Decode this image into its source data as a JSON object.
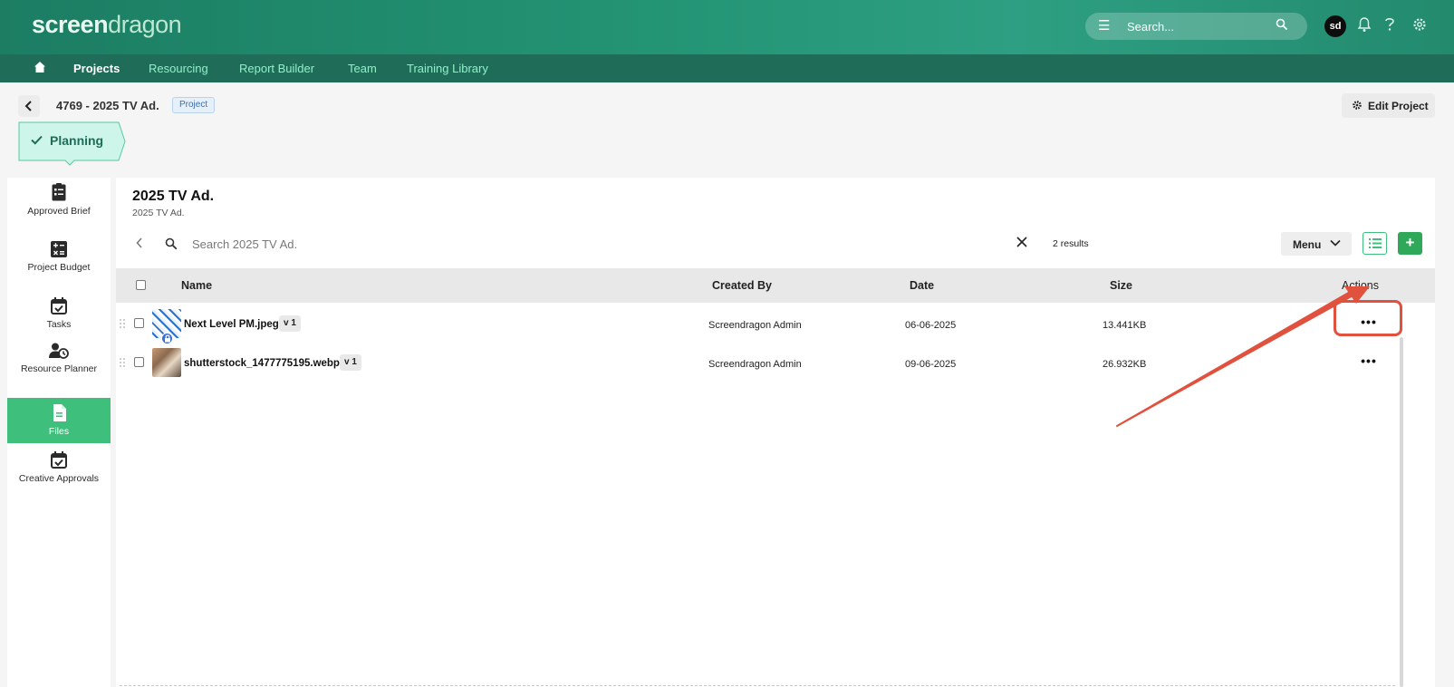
{
  "app": {
    "logo_main": "screen",
    "logo_accent": "dragon",
    "search_placeholder": "Search...",
    "avatar_initials": "sd"
  },
  "nav": {
    "items": [
      {
        "label": "Projects",
        "active": true
      },
      {
        "label": "Resourcing",
        "active": false
      },
      {
        "label": "Report Builder",
        "active": false
      },
      {
        "label": "Team",
        "active": false
      },
      {
        "label": "Training Library",
        "active": false
      }
    ]
  },
  "project": {
    "title": "4769 - 2025 TV Ad.",
    "badge": "Project",
    "edit_label": "Edit Project",
    "stage_label": "Planning"
  },
  "sidebar": {
    "items": [
      {
        "label": "Approved Brief",
        "icon": "brief-icon"
      },
      {
        "label": "Project Budget",
        "icon": "budget-icon"
      },
      {
        "label": "Tasks",
        "icon": "tasks-icon"
      },
      {
        "label": "Resource Planner",
        "icon": "resource-planner-icon"
      },
      {
        "label": "Files",
        "icon": "file-icon",
        "active": true
      },
      {
        "label": "Creative Approvals",
        "icon": "approvals-icon"
      }
    ]
  },
  "main": {
    "title": "2025 TV Ad.",
    "subtitle": "2025 TV Ad.",
    "search_placeholder": "Search 2025 TV Ad.",
    "results": "2 results",
    "menu_label": "Menu",
    "add_label": "+"
  },
  "table": {
    "columns": [
      "Name",
      "Created By",
      "Date",
      "Size",
      "Actions"
    ],
    "rows": [
      {
        "name": "Next Level PM.jpeg",
        "version": "v 1",
        "created_by": "Screendragon Admin",
        "date": "06-06-2025",
        "size": "13.441KB",
        "locked": true
      },
      {
        "name": "shutterstock_1477775195.webp",
        "version": "v 1",
        "created_by": "Screendragon Admin",
        "date": "09-06-2025",
        "size": "26.932KB",
        "locked": false
      }
    ],
    "actions_label": "•••"
  },
  "colors": {
    "header": "#239474",
    "nav": "#1f6d58",
    "accent": "#3fbf7c",
    "annotation": "#e0513e"
  }
}
